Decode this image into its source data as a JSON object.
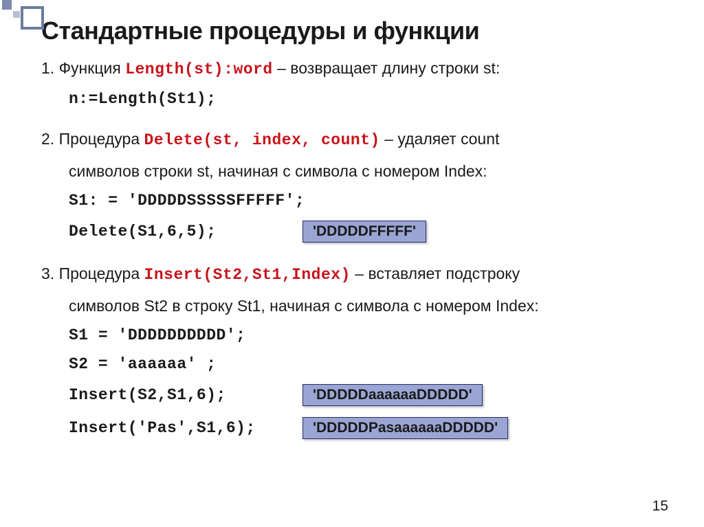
{
  "title": "Стандартные процедуры и функции",
  "item1": {
    "prefix": "1. Функция ",
    "sig": "Length(st):word",
    "suffix": " – возвращает длину строки st:",
    "code": "n:=Length(St1);"
  },
  "item2": {
    "prefix": "2. Процедура ",
    "sig": "Delete(st, index, count)",
    "suffix": " – удаляет count",
    "line2": "символов строки st, начиная с символа с номером Index:",
    "code1": "S1: = 'DDDDDSSSSSFFFFF';",
    "code2": "Delete(S1,6,5);",
    "chip": "'DDDDDFFFFF'"
  },
  "item3": {
    "prefix": "3. Процедура ",
    "sig": "Insert(St2,St1,Index)",
    "suffix": " – вставляет подстроку",
    "line2": "символов St2 в строку St1, начиная с символа с номером Index:",
    "code1": "S1 = 'DDDDDDDDDD';",
    "code2": "S2 = 'aaaaaa' ;",
    "code3": "Insert(S2,S1,6);",
    "chip1": "'DDDDDaaaaaaDDDDD'",
    "code4": "Insert('Pas',S1,6);",
    "chip2": "'DDDDDPasaaaaaaDDDDD'"
  },
  "pageNum": "15"
}
